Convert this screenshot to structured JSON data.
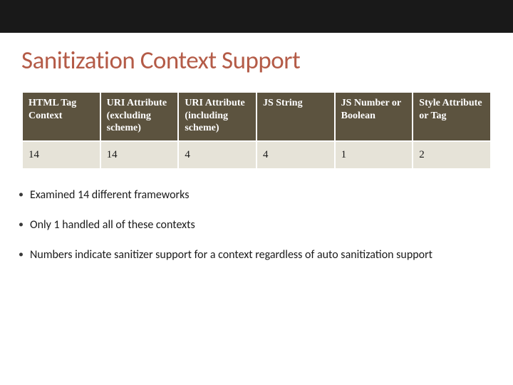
{
  "title": "Sanitization Context Support",
  "chart_data": {
    "type": "table",
    "headers": [
      "HTML Tag Context",
      "URI Attribute (excluding scheme)",
      "URI Attribute (including scheme)",
      "JS String",
      "JS Number or Boolean",
      "Style Attribute or Tag"
    ],
    "rows": [
      [
        "14",
        "14",
        "4",
        "4",
        "1",
        "2"
      ]
    ]
  },
  "bullets": [
    "Examined 14 different frameworks",
    "Only 1 handled all of these contexts",
    "Numbers indicate sanitizer support for a context regardless of auto sanitization support"
  ]
}
